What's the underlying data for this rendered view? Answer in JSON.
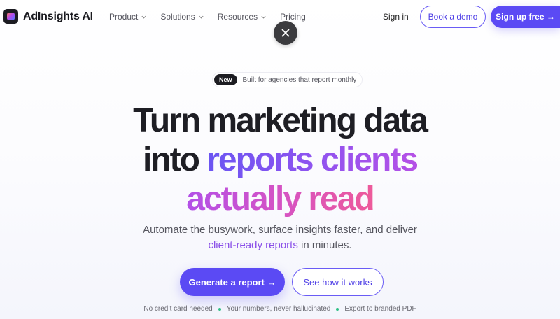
{
  "brand": {
    "name": "AdInsights AI",
    "logo_icon": "app-logo-icon"
  },
  "nav": {
    "menu": [
      {
        "label": "Product",
        "has_dropdown": true
      },
      {
        "label": "Solutions",
        "has_dropdown": true
      },
      {
        "label": "Resources",
        "has_dropdown": true
      },
      {
        "label": "Pricing",
        "has_dropdown": false
      }
    ],
    "sign_in": "Sign in",
    "book_demo": "Book a demo",
    "sign_up": "Sign up free →"
  },
  "overlay": {
    "close_icon": "close-icon"
  },
  "hero": {
    "badge": "New",
    "badge_text": "Built for agencies that report monthly",
    "headline_line1": "Turn marketing data",
    "headline_line2_plain": "into ",
    "headline_line2_accent": "reports clients",
    "headline_line3_accent": "actually read",
    "subheading_part1": "Automate the busywork, surface insights faster, and deliver",
    "subheading_link": "client-ready reports",
    "subheading_part2": " in minutes.",
    "cta_primary": "Generate a report →",
    "cta_secondary": "See how it works",
    "benefits": [
      "No credit card needed",
      "Your numbers, never hallucinated",
      "Export to branded PDF"
    ]
  },
  "colors": {
    "accent": "#5b4af4",
    "accent_gradient_start": "#6b55f2",
    "accent_gradient_end": "#ee5a9a",
    "benefit_dot": "#2fbf86"
  }
}
